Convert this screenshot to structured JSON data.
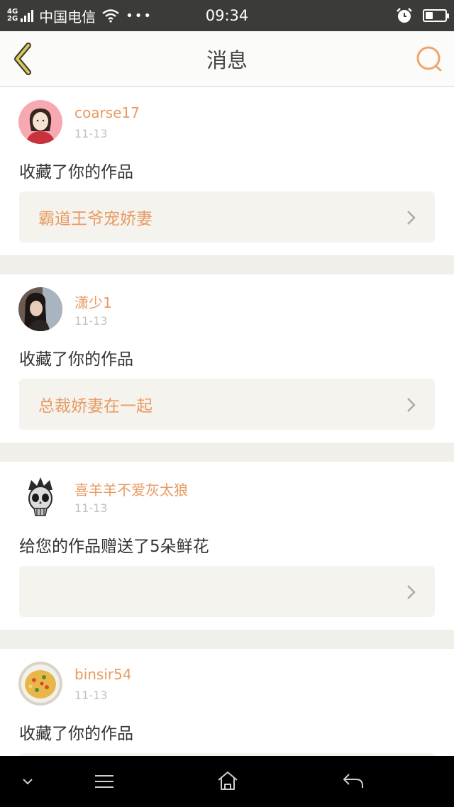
{
  "status_bar": {
    "network_top": "4G",
    "network_bottom": "2G",
    "carrier": "中国电信",
    "more": "•••",
    "time": "09:34",
    "battery_level": 0.4
  },
  "header": {
    "title": "消息"
  },
  "messages": [
    {
      "username": "coarse17",
      "date": "11-13",
      "action": "收藏了你的作品",
      "work_title": "霸道王爷宠娇妻"
    },
    {
      "username": "潇少1",
      "date": "11-13",
      "action": "收藏了你的作品",
      "work_title": "总裁娇妻在一起"
    },
    {
      "username": "喜羊羊不爱灰太狼",
      "date": "11-13",
      "action": "给您的作品赠送了5朵鲜花",
      "work_title": ""
    },
    {
      "username": "binsir54",
      "date": "11-13",
      "action": "收藏了你的作品",
      "work_title": ""
    }
  ],
  "colors": {
    "accent": "#e99a62",
    "status_bar": "#3b3b39",
    "page_bg": "#f0efea"
  }
}
